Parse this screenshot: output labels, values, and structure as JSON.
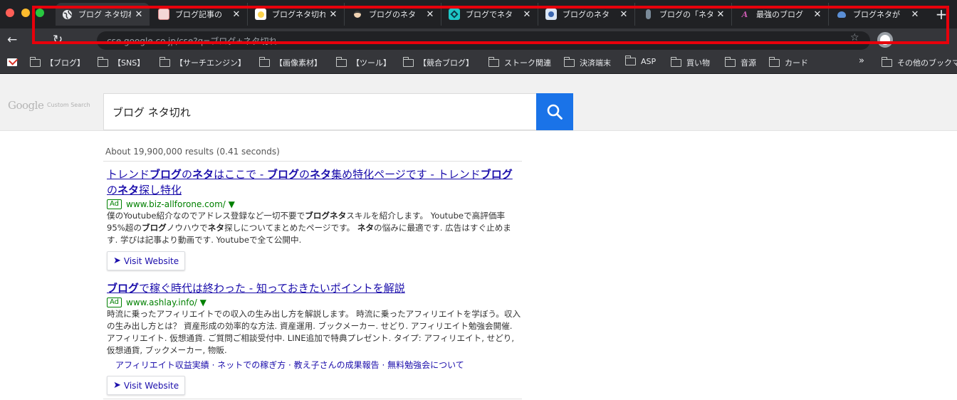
{
  "tabs": [
    {
      "title": "ブログ ネタ切れ",
      "favicon": "globe-icon",
      "fav_color": "#e8eaed",
      "active": true
    },
    {
      "title": "ブログ記事の",
      "favicon": "site-favicon",
      "fav_color": "#f4d6d6"
    },
    {
      "title": "ブログネタ切れ",
      "favicon": "site-favicon",
      "fav_color": "#fbd34d"
    },
    {
      "title": "ブログのネタ",
      "favicon": "site-favicon",
      "fav_color": "#3a3a3a"
    },
    {
      "title": "ブログでネタ",
      "favicon": "site-favicon",
      "fav_color": "#1ec7c7"
    },
    {
      "title": "ブログのネタ",
      "favicon": "site-favicon",
      "fav_color": "#dbe6f5"
    },
    {
      "title": "ブログの「ネタ",
      "favicon": "site-favicon",
      "fav_color": "#7a8a99"
    },
    {
      "title": "最強のブログ",
      "favicon": "site-favicon",
      "fav_color": "#c85ab0"
    },
    {
      "title": "ブログネタが",
      "favicon": "site-favicon",
      "fav_color": "#5b8fd6"
    }
  ],
  "toolbar": {
    "back": "←",
    "reload": "↻",
    "url": "cse.google.co.jp/cse?q=ブログ+ネタ切れ",
    "star": "☆"
  },
  "bookmarks": {
    "items": [
      {
        "label": "【ブログ】"
      },
      {
        "label": "【SNS】"
      },
      {
        "label": "【サーチエンジン】"
      },
      {
        "label": "【画像素材】"
      },
      {
        "label": "【ツール】"
      },
      {
        "label": "【競合ブログ】"
      },
      {
        "label": "ストーク関連"
      },
      {
        "label": "決済端末"
      },
      {
        "label": "ASP"
      },
      {
        "label": "買い物"
      },
      {
        "label": "音源"
      },
      {
        "label": "カード"
      }
    ],
    "more": "»",
    "other": "その他のブックマーク"
  },
  "search": {
    "logo": "Google",
    "logo_sub": "Custom Search",
    "query": "ブログ ネタ切れ",
    "button_icon": "search-icon"
  },
  "results": {
    "stats": "About 19,900,000 results (0.41 seconds)",
    "items": [
      {
        "title_segments": [
          {
            "text": "トレンド",
            "bold": false
          },
          {
            "text": "ブログ",
            "bold": true
          },
          {
            "text": "の",
            "bold": false
          },
          {
            "text": "ネタ",
            "bold": true
          },
          {
            "text": "はここで - ",
            "bold": false
          },
          {
            "text": "ブログ",
            "bold": true
          },
          {
            "text": "の",
            "bold": false
          },
          {
            "text": "ネタ",
            "bold": true
          },
          {
            "text": "集め特化ページです - トレンド",
            "bold": false
          },
          {
            "text": "ブログ",
            "bold": true
          },
          {
            "text": "の",
            "bold": false
          },
          {
            "text": "ネタ",
            "bold": true
          },
          {
            "text": "探し特化",
            "bold": false
          }
        ],
        "ad": "Ad",
        "url": "www.biz-allforone.com/ ▼",
        "snippet_segments": [
          {
            "text": "僕のYoutube紹介なのでアドレス登録など一切不要で",
            "bold": false
          },
          {
            "text": "ブログネタ",
            "bold": true
          },
          {
            "text": "スキルを紹介します。 Youtubeで高評価率95%超の",
            "bold": false
          },
          {
            "text": "ブログ",
            "bold": true
          },
          {
            "text": "ノウハウで",
            "bold": false
          },
          {
            "text": "ネタ",
            "bold": true
          },
          {
            "text": "探しについてまとめたページです。 ",
            "bold": false
          },
          {
            "text": "ネタ",
            "bold": true
          },
          {
            "text": "の悩みに最適です. 広告はすぐ止めます. 学びは記事より動画です. Youtubeで全て公開中.",
            "bold": false
          }
        ],
        "sitelinks": "",
        "visit": "Visit Website"
      },
      {
        "title_segments": [
          {
            "text": "ブログ",
            "bold": true
          },
          {
            "text": "で稼ぐ時代は終わった - 知っておきたいポイントを解説",
            "bold": false
          }
        ],
        "ad": "Ad",
        "url": "www.ashlay.info/ ▼",
        "snippet_segments": [
          {
            "text": "時流に乗ったアフィリエイトでの収入の生み出し方を解説します。 時流に乗ったアフィリエイトを学ぼう。収入の生み出し方とは？ 資産形成の効率的な方法. 資産運用. ブックメーカー. せどり. アフィリエイト勉強会開催. アフィリエイト. 仮想通貨. ご質問ご相談受付中. LINE追加で特典プレゼント. タイプ: アフィリエイト, せどり, 仮想通貨, ブックメーカー, 物販.",
            "bold": false
          }
        ],
        "sitelinks": "アフィリエイト収益実績 · ネットでの稼ぎ方 · 教え子さんの成果報告 · 無料勉強会について",
        "visit": "Visit Website"
      }
    ]
  },
  "colors": {
    "highlight_box": "#e8000b",
    "search_button": "#1a73e8",
    "link": "#1a0dab",
    "ad_green": "#008000"
  }
}
